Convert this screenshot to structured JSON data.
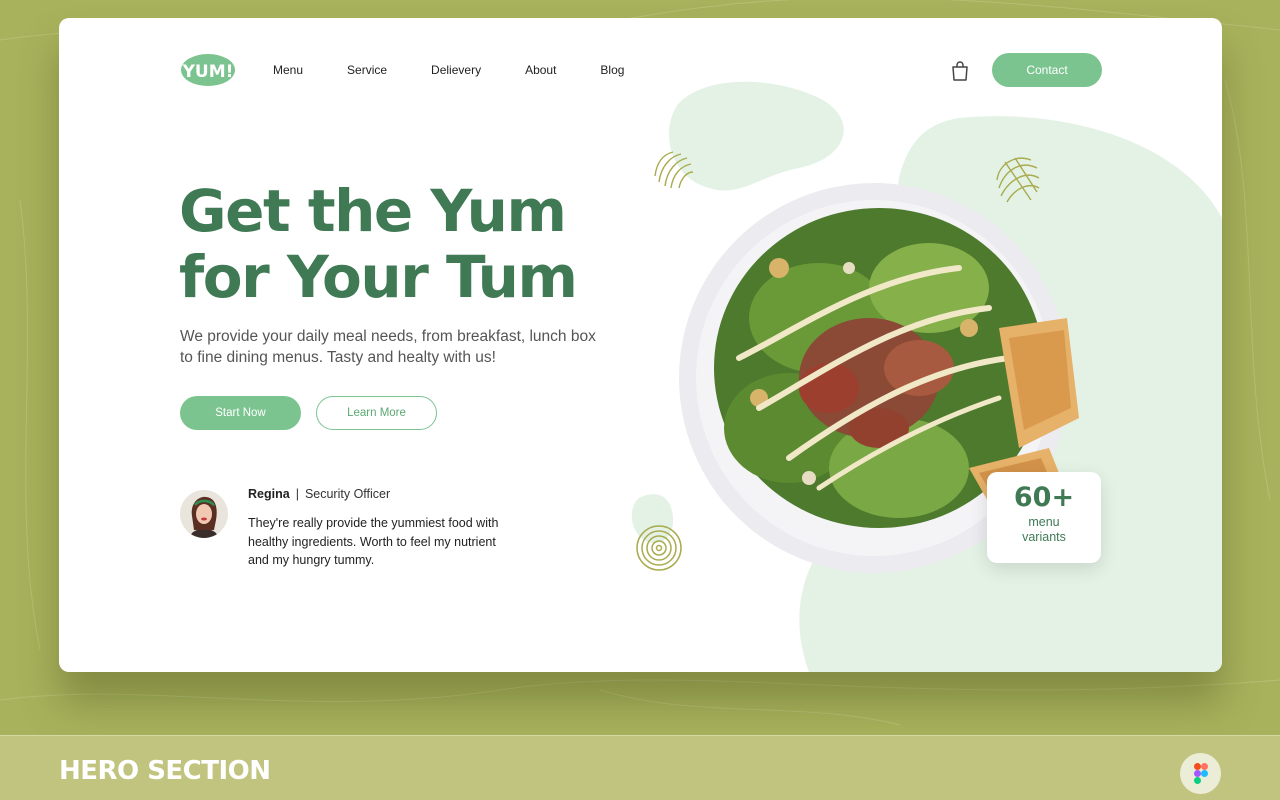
{
  "brand": {
    "logo_text": "YUM!"
  },
  "nav": {
    "items": [
      "Menu",
      "Service",
      "Delievery",
      "About",
      "Blog"
    ]
  },
  "header": {
    "contact_label": "Contact"
  },
  "hero": {
    "headline_line1": "Get the Yum",
    "headline_line2": "for Your Tum",
    "subtext": "We provide your daily meal needs, from breakfast, lunch box to fine dining menus. Tasty and healty with us!",
    "start_label": "Start Now",
    "learn_label": "Learn More"
  },
  "testimonial": {
    "name": "Regina",
    "separator": "|",
    "role": "Security Officer",
    "quote": "They're really provide the yummiest food with healthy ingredients. Worth to feel my nutrient and my hungry tummy."
  },
  "stat": {
    "number": "60+",
    "label": "menu variants"
  },
  "footer": {
    "section_title": "HERO SECTION"
  },
  "colors": {
    "background": "#a8b25c",
    "accent": "#7bc48f",
    "headline": "#3f7a55",
    "blob": "#e4f2e6",
    "footer": "#c0c47e"
  },
  "icons": [
    "shopping-bag-icon",
    "figma-icon",
    "scribble-doodle",
    "spiral-doodle"
  ]
}
